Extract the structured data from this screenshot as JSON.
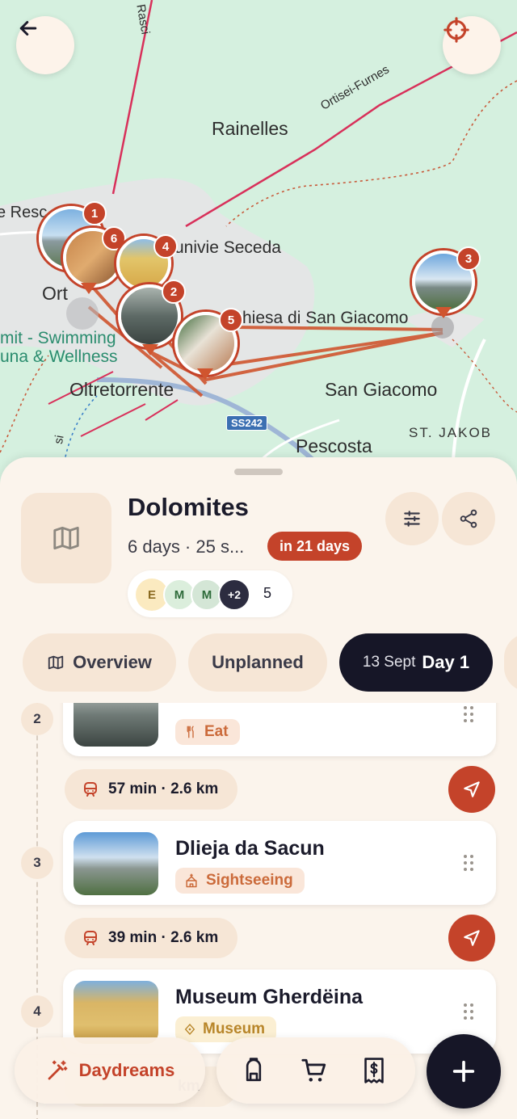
{
  "map": {
    "labels": {
      "rainelles": "Rainelles",
      "ortisei_furnes": "Ortisei-Furnes",
      "rasci": "Rasci",
      "seceda": "univie Seceda",
      "resc": "e Resc",
      "ort": "Ort",
      "chiesa": "hiesa di San Giacomo",
      "swimming": "mit - Swimming",
      "wellness": "una & Wellness",
      "oltretorrente": "Oltretorrente",
      "san_giacomo": "San Giacomo",
      "st_jakob": "ST. JAKOB",
      "pescosta": "Pescosta",
      "si": "si",
      "road": "SS242"
    },
    "pins": [
      "1",
      "2",
      "3",
      "4",
      "5",
      "6"
    ],
    "accent": "#c4432a"
  },
  "trip": {
    "title": "Dolomites",
    "meta": "6 days · 25 s...",
    "due": "in 21 days",
    "members": {
      "avatars": [
        "E",
        "M",
        "M"
      ],
      "overflow": "+2",
      "count": "5"
    }
  },
  "tabs": {
    "overview": "Overview",
    "unplanned": "Unplanned",
    "day_date": "13 Sept",
    "day_label": "Day 1"
  },
  "itinerary": {
    "stops": [
      {
        "index": "2",
        "name": "",
        "category": "Eat"
      },
      {
        "index": "3",
        "name": "Dlieja da Sacun",
        "category": "Sightseeing"
      },
      {
        "index": "4",
        "name": "Museum Gherdëina",
        "category": "Museum"
      }
    ],
    "legs": [
      {
        "text": "57 min · 2.6 km"
      },
      {
        "text": "39 min · 2.6 km"
      },
      {
        "text": "km"
      }
    ]
  },
  "bottombar": {
    "daydreams": "Daydreams"
  },
  "icons": {
    "back": "arrow-left-icon",
    "locate": "crosshair-icon",
    "map": "map-icon",
    "filter": "sliders-icon",
    "share": "share-icon",
    "restaurant": "utensils-icon",
    "church": "church-icon",
    "museum": "museum-icon",
    "car": "car-icon",
    "navigate": "navigate-icon",
    "drag": "drag-handle-icon",
    "wand": "magic-wand-icon",
    "backpack": "backpack-icon",
    "cart": "cart-icon",
    "receipt": "receipt-icon",
    "plus": "plus-icon"
  }
}
